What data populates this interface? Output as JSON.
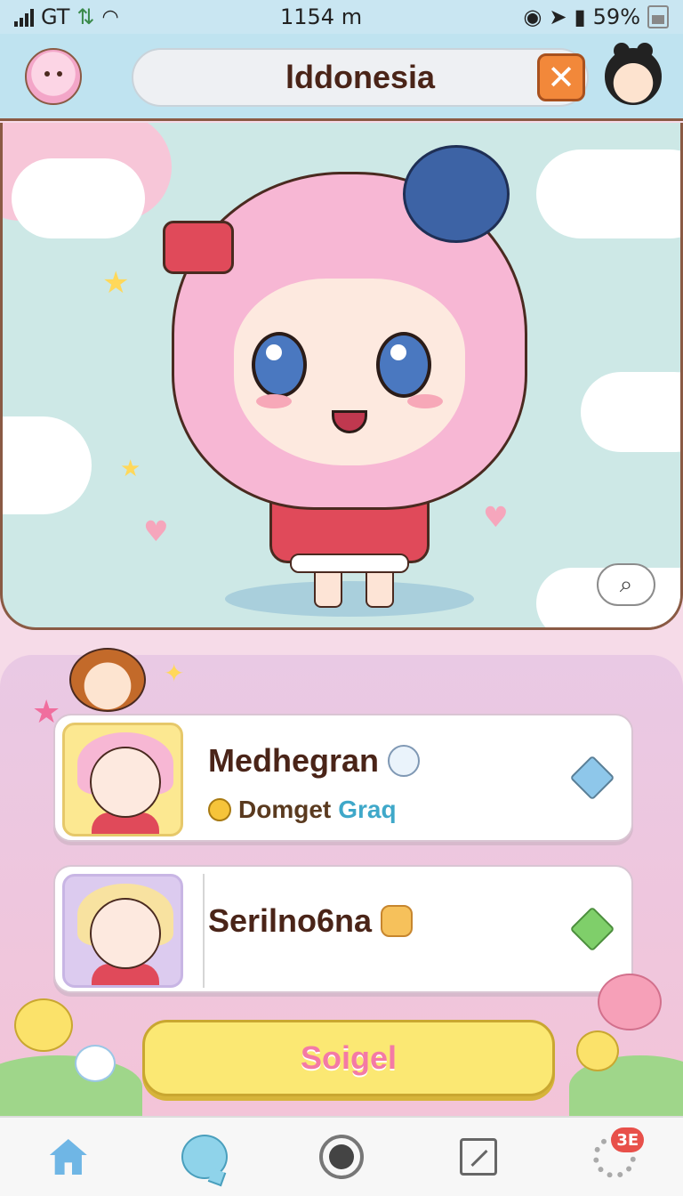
{
  "status_bar": {
    "carrier": "GT",
    "time": "1154 m",
    "battery": "59%"
  },
  "header": {
    "title": "lddonesia",
    "close_icon": "close-x-icon",
    "left_avatar": "pink-chibi-avatar",
    "right_avatar": "dark-hair-chibi-avatar"
  },
  "hero": {
    "image": "pink-haired-chibi-girl",
    "zoom_icon": "magnifier-icon"
  },
  "list": {
    "items": [
      {
        "name": "Medhegran",
        "subtitle_primary": "Domget",
        "subtitle_accent": "Graq",
        "status_icon": "blue-diamond-icon",
        "status_color": "#8ec7ea"
      },
      {
        "name": "Serilno6na",
        "status_icon": "green-diamond-icon",
        "status_color": "#7fcf6a"
      }
    ]
  },
  "action": {
    "label": "Soigel"
  },
  "bottom_nav": {
    "items": [
      {
        "icon": "home-icon"
      },
      {
        "icon": "chat-icon"
      },
      {
        "icon": "record-icon"
      },
      {
        "icon": "edit-icon"
      },
      {
        "icon": "gear-icon",
        "badge": "3E"
      }
    ]
  },
  "colors": {
    "header_bg": "#bfe3f0",
    "accent_orange": "#f2883a",
    "action_yellow": "#fbe873",
    "action_text_pink": "#f47aa5",
    "badge_red": "#e8504a"
  }
}
